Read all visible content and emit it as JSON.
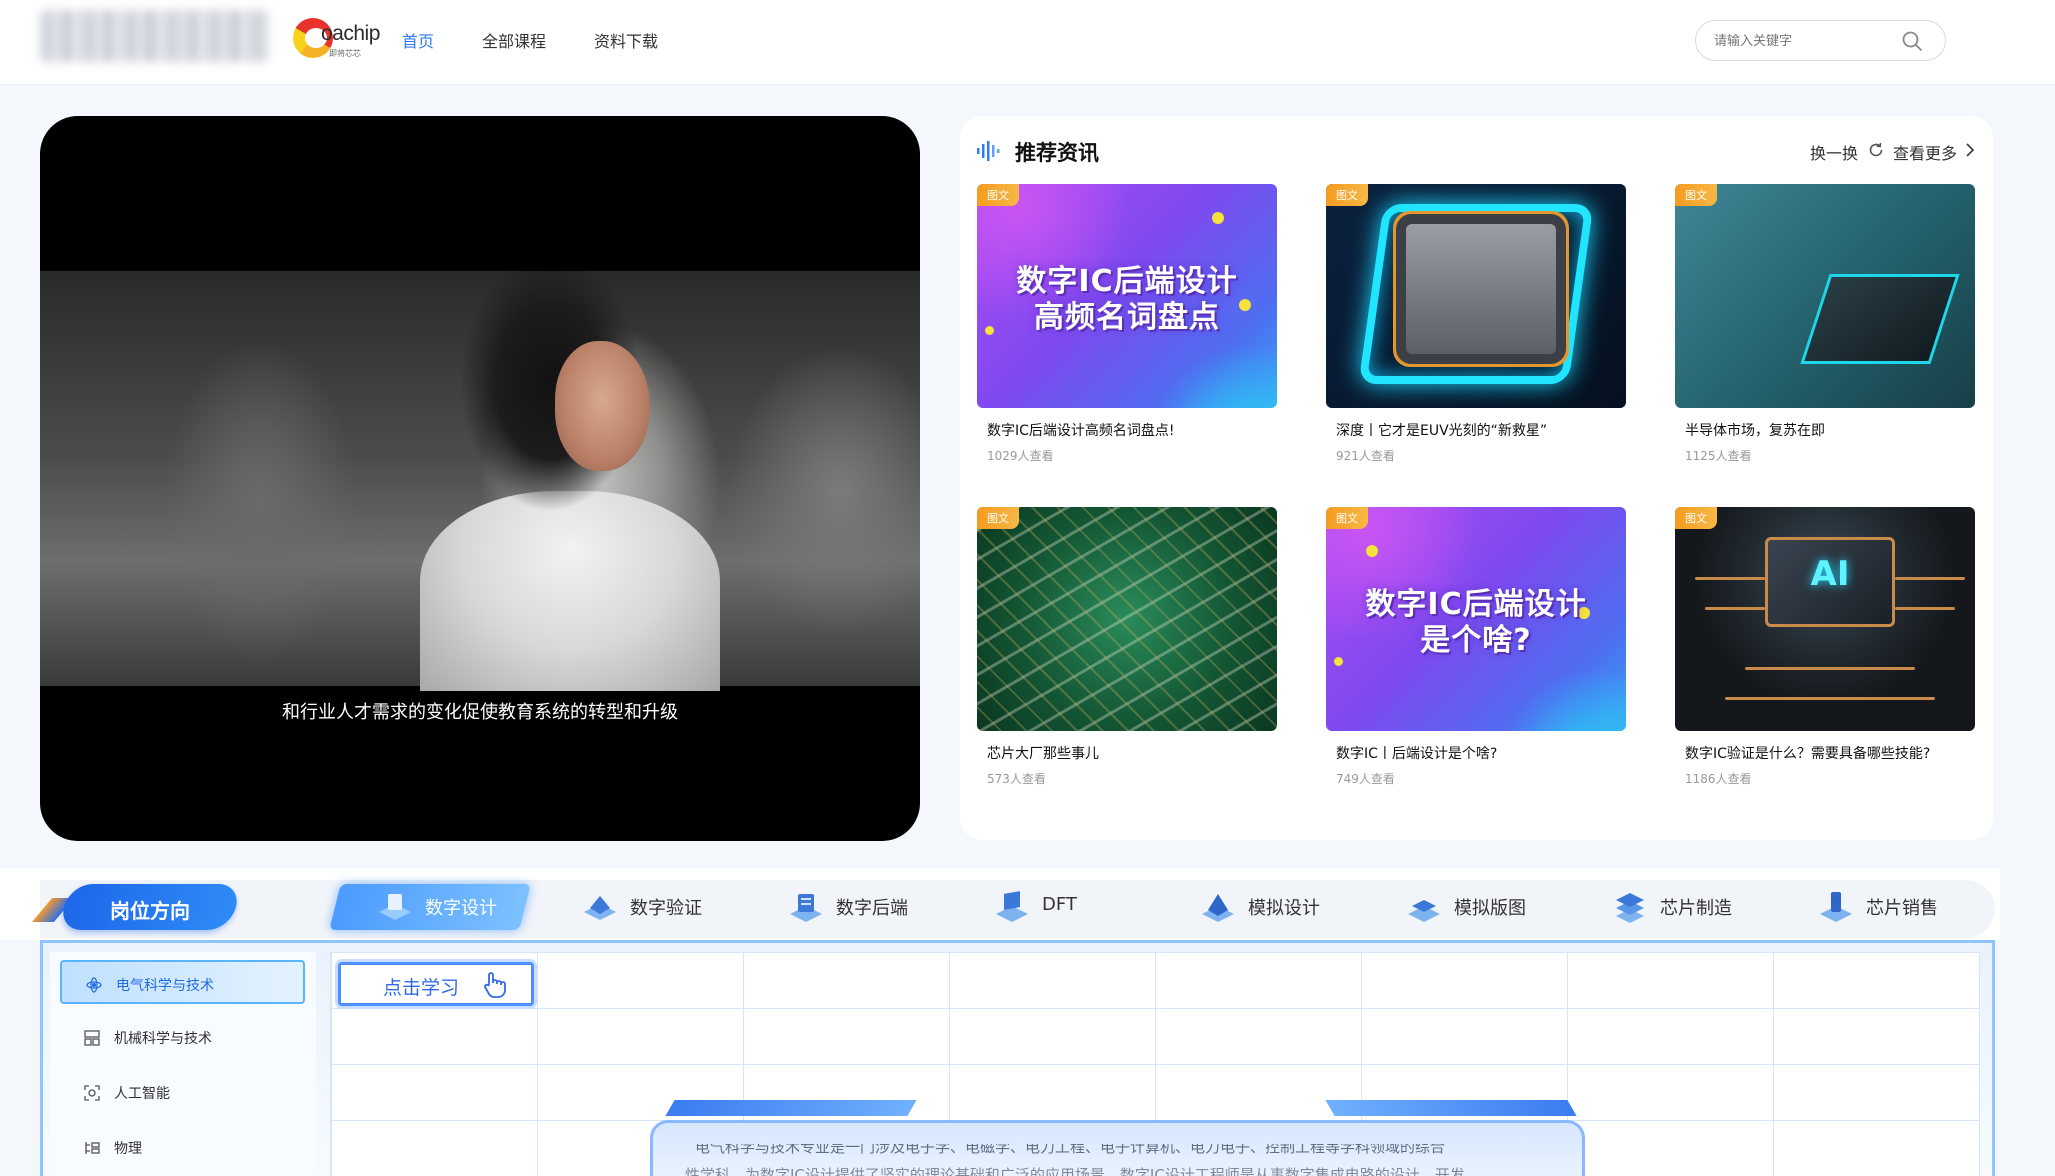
{
  "header": {
    "brand_word": "oachip",
    "brand_sub": "即将芯芯",
    "nav": [
      {
        "label": "首页",
        "active": true
      },
      {
        "label": "全部课程",
        "active": false
      },
      {
        "label": "资料下载",
        "active": false
      }
    ],
    "search": {
      "placeholder": "请输入关键字",
      "icon": "search-icon"
    }
  },
  "video": {
    "caption": "和行业人才需求的变化促使教育系统的转型和升级"
  },
  "news": {
    "title": "推荐资讯",
    "switch_label": "换一换",
    "more_label": "查看更多",
    "tag": "图文",
    "cards": [
      {
        "title": "数字IC后端设计高频名词盘点!",
        "views": "1029人查看",
        "thumb_text": [
          "数字IC后端设计",
          "高频名词盘点"
        ]
      },
      {
        "title": "深度丨它才是EUV光刻的“新救星”",
        "views": "921人查看"
      },
      {
        "title": "半导体市场，复苏在即",
        "views": "1125人查看"
      },
      {
        "title": "芯片大厂那些事儿",
        "views": "573人查看"
      },
      {
        "title": "数字IC丨后端设计是个啥?",
        "views": "749人查看",
        "thumb_text": [
          "数字IC后端设计",
          "是个啥?"
        ]
      },
      {
        "title": "数字IC验证是什么？需要具备哪些技能?",
        "views": "1186人查看",
        "thumb_text": [
          "AI"
        ]
      }
    ]
  },
  "jobs": {
    "title": "岗位方向",
    "tabs": [
      {
        "label": "数字设计",
        "active": true
      },
      {
        "label": "数字验证",
        "active": false
      },
      {
        "label": "数字后端",
        "active": false
      },
      {
        "label": "DFT",
        "active": false
      },
      {
        "label": "模拟设计",
        "active": false
      },
      {
        "label": "模拟版图",
        "active": false
      },
      {
        "label": "芯片制造",
        "active": false
      },
      {
        "label": "芯片销售",
        "active": false
      }
    ]
  },
  "majors": {
    "items": [
      {
        "label": "电气科学与技术",
        "active": true,
        "icon": "atom-icon"
      },
      {
        "label": "机械科学与技术",
        "active": false,
        "icon": "grid-icon"
      },
      {
        "label": "人工智能",
        "active": false,
        "icon": "scan-icon"
      },
      {
        "label": "物理",
        "active": false,
        "icon": "list-icon"
      }
    ],
    "learn_button": "点击学习",
    "desc_line1": "电气科学与技术专业是一门涉及电子学、电磁学、电力工程、电子计算机、电力电子、控制工程等学科领域的综合",
    "desc_line2": "性学科，为数字IC设计提供了坚实的理论基础和广泛的应用场景。数字IC设计工程师是从事数字集成电路的设计、开发"
  },
  "colors": {
    "accent": "#2f7bf6",
    "tag_orange": "#f59b1f",
    "panel_border": "#8fc4ff"
  }
}
